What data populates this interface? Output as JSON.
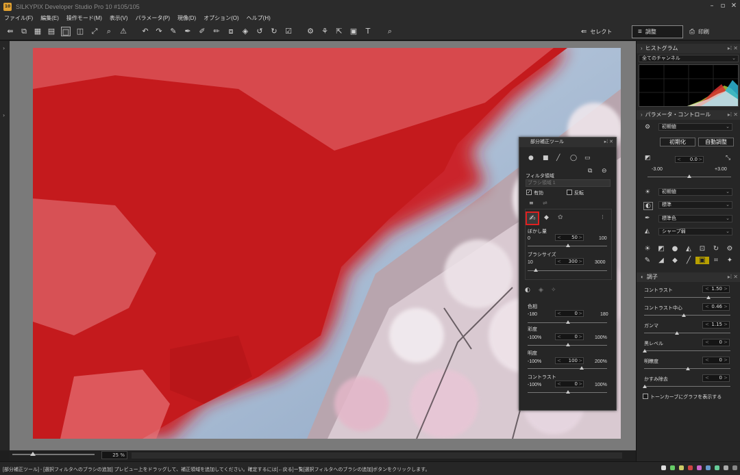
{
  "window": {
    "title": "SILKYPIX Developer Studio Pro 10   #105/105"
  },
  "menu": [
    "ファイル(F)",
    "編集(E)",
    "操作モード(M)",
    "表示(V)",
    "パラメータ(P)",
    "現像(D)",
    "オプション(O)",
    "ヘルプ(H)"
  ],
  "modes": {
    "select": "セレクト",
    "adjust": "調整",
    "print": "印刷"
  },
  "zoom": {
    "value": "25 %"
  },
  "status": {
    "text": "[部分補正ツール] - [選択フィルタへのブラシの追加] プレビュー上をドラッグして、補正領域を追加してください。確定するには[←戻る]ー覧[選択フィルタへのブラシの追加]ボタンをクリックします。"
  },
  "histogram": {
    "title": "ヒストグラム",
    "channel": "全てのチャンネル"
  },
  "param_control": {
    "title": "パラメータ・コントロール",
    "preset": "初期値",
    "reset_button": "初期化",
    "auto_button": "自動調整",
    "exposure_value": "0.0",
    "exposure_min": "-3.00",
    "exposure_max": "+3.00",
    "wb_preset": "初期値",
    "tone_preset": "標準",
    "color_preset": "標準色",
    "sharp_preset": "シャープ弱"
  },
  "tone": {
    "title": "調子",
    "sliders": [
      {
        "label": "コントラスト",
        "value": "1.50"
      },
      {
        "label": "コントラスト中心",
        "value": "0.46"
      },
      {
        "label": "ガンマ",
        "value": "1.15"
      },
      {
        "label": "黒レベル",
        "value": "0"
      },
      {
        "label": "明瞭度",
        "value": "0"
      },
      {
        "label": "かすみ除去",
        "value": "0"
      }
    ],
    "tone_curve_checkbox": "トーンカーブにグラフを表示する"
  },
  "partial_tool": {
    "title": "部分補正ツール",
    "filter_area_label": "フィルタ領域",
    "filter_area_value": "ブラシ領域 1",
    "enabled_label": "有効",
    "invert_label": "反転",
    "blur_label": "ぼかし量",
    "blur_min": "0",
    "blur_value": "50",
    "blur_max": "100",
    "brush_size_label": "ブラシサイズ",
    "brush_min": "10",
    "brush_value": "300",
    "brush_max": "3000",
    "hue_label": "色相",
    "hue_min": "-180",
    "hue_value": "0",
    "hue_max": "180",
    "sat_label": "彩度",
    "sat_min": "-100%",
    "sat_value": "0",
    "sat_max": "100%",
    "bright_label": "明度",
    "bright_min": "-100%",
    "bright_value": "100",
    "bright_max": "200%",
    "contrast_label": "コントラスト",
    "contrast_min": "-100%",
    "contrast_value": "0",
    "contrast_max": "100%"
  }
}
